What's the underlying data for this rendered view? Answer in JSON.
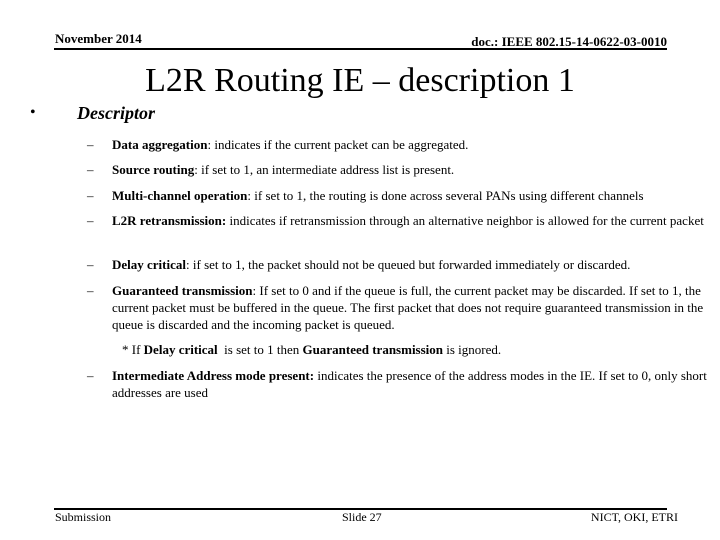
{
  "header": {
    "date": "November 2014",
    "doc": "doc.: IEEE 802.15-14-0622-03-0010"
  },
  "title": "L2R Routing IE – description 1",
  "section": {
    "bullet": "•",
    "heading": "Descriptor",
    "dash": "–",
    "items": [
      {
        "term": "Data aggregation",
        "sep": ": ",
        "desc": "indicates if the current packet can be aggregated."
      },
      {
        "term": "Source routing",
        "sep": ": ",
        "desc": "if set to 1, an intermediate address list is present."
      },
      {
        "term": "Multi-channel operation",
        "sep": ": ",
        "desc": "if set to 1, the routing is done across several PANs using different channels"
      },
      {
        "term": "L2R retransmission:",
        "sep": " ",
        "desc": "indicates if retransmission through an alternative neighbor is allowed for the current packet"
      },
      {
        "term": "Delay critical",
        "sep": ": ",
        "desc": "if set to 1, the packet should not be queued but forwarded immediately or discarded."
      },
      {
        "term": "Guaranteed transmission",
        "sep": ": ",
        "desc": "If set to 0 and if the queue is full, the current packet may be discarded. If set to 1, the current packet must be buffered in the queue. The first packet that does not require guaranteed transmission in the queue is discarded and the incoming packet is queued."
      },
      {
        "term": "Intermediate Address mode present:",
        "sep": " ",
        "desc": "indicates the presence of the address modes in the IE. If set to 0, only short addresses are used"
      }
    ],
    "note": {
      "prefix": "* If ",
      "term1": "Delay critical",
      "mid": "  is set to 1 then ",
      "term2": "Guaranteed transmission",
      "suffix": " is ignored."
    }
  },
  "footer": {
    "left": "Submission",
    "center": "Slide 27",
    "right": "NICT, OKI, ETRI"
  }
}
